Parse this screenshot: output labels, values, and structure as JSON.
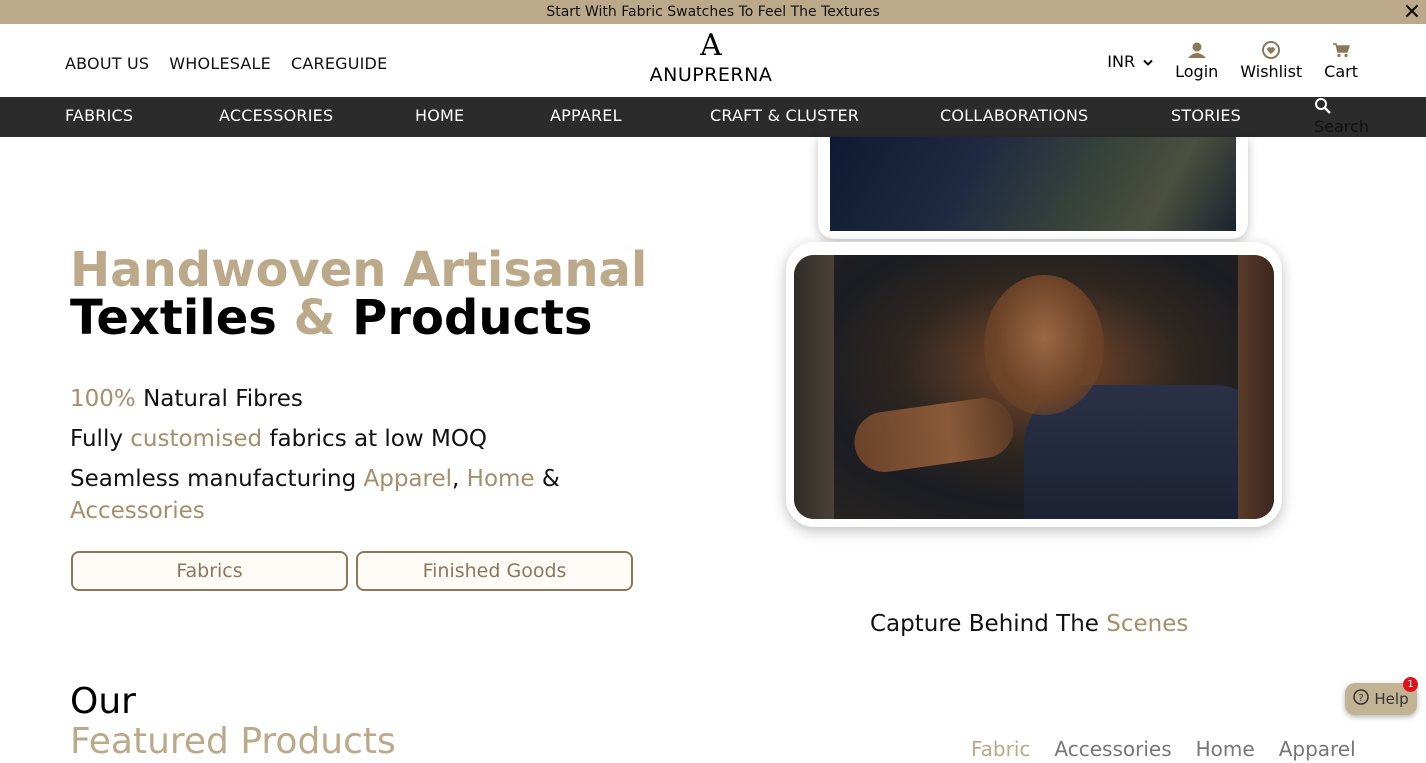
{
  "announcement": {
    "text": "Start With Fabric Swatches To Feel The Textures"
  },
  "header": {
    "links": [
      "ABOUT US",
      "WHOLESALE",
      "CAREGUIDE"
    ],
    "logo_mark": "A",
    "logo_text": "ANUPRERNA",
    "currency": "INR",
    "login": "Login",
    "wishlist": "Wishlist",
    "cart": "Cart"
  },
  "nav": {
    "items": [
      "FABRICS",
      "ACCESSORIES",
      "HOME",
      "APPAREL",
      "CRAFT & CLUSTER",
      "COLLABORATIONS",
      "STORIES"
    ],
    "search": "Search"
  },
  "hero": {
    "title_line1": "Handwoven Artisanal",
    "title_line2_a": "Textiles ",
    "title_line2_amp": "&",
    "title_line2_b": " Products",
    "f1_highlight": "100%",
    "f1_rest": " Natural Fibres",
    "f2_a": "Fully ",
    "f2_highlight": "customised",
    "f2_b": " fabrics at low MOQ",
    "f3_a": "Seamless manufacturing ",
    "f3_h1": "Apparel",
    "f3_comma": ", ",
    "f3_h2": "Home",
    "f3_amp": " &",
    "f3_h3": "Accessories",
    "btn_fabrics": "Fabrics",
    "btn_finished": "Finished Goods"
  },
  "video": {
    "caption_a": "Capture Behind The ",
    "caption_b": "Scenes"
  },
  "featured": {
    "line1": "Our",
    "line2": "Featured Products",
    "tabs": [
      "Fabric",
      "Accessories",
      "Home",
      "Apparel"
    ],
    "active_tab": "Fabric"
  },
  "help": {
    "label": "Help",
    "badge": "1"
  },
  "colors": {
    "accent": "#bca98a",
    "nav_bg": "#2b2b2b",
    "button_border": "#8c7759"
  }
}
